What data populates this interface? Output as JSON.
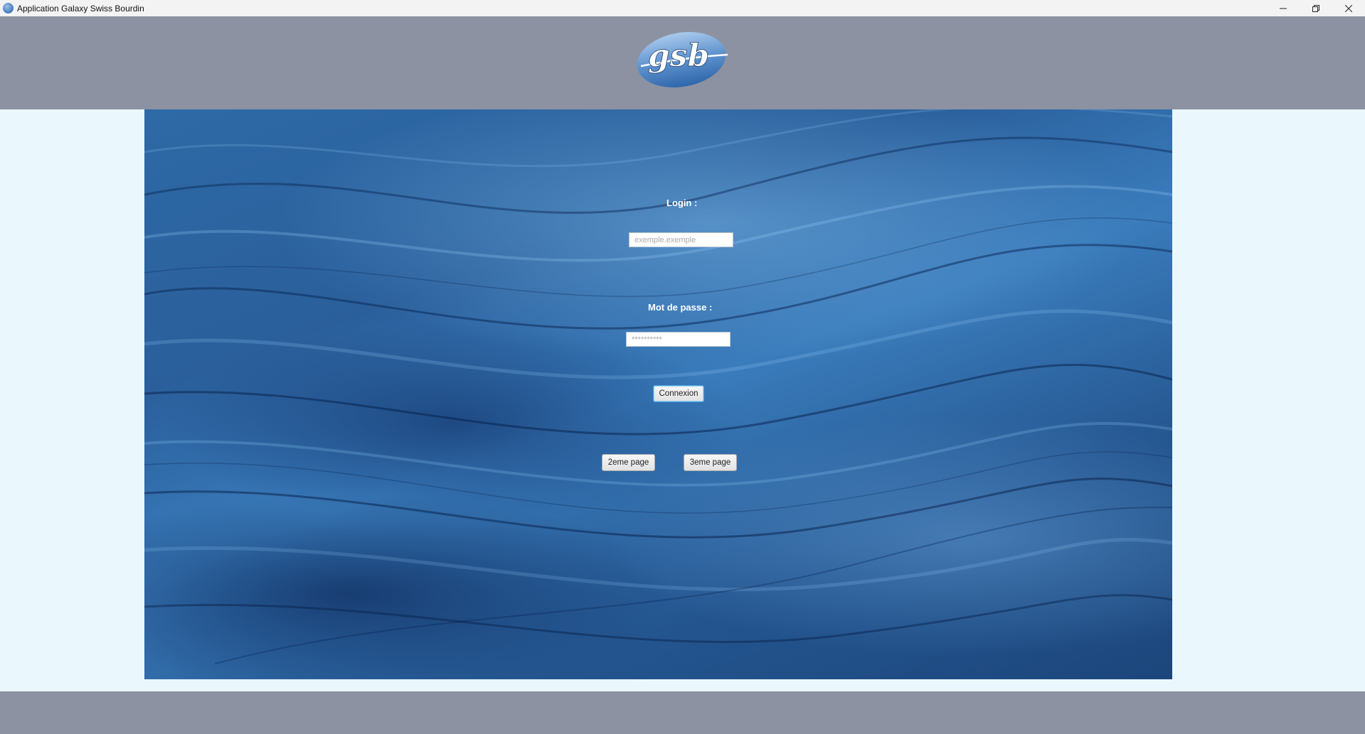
{
  "window": {
    "title": "Application Galaxy Swiss Bourdin",
    "icon": "gsb-app-icon",
    "controls": [
      "minimize-icon",
      "restore-icon",
      "close-icon"
    ]
  },
  "header": {
    "logo_text": "gsb"
  },
  "form": {
    "login_label": "Login :",
    "login_placeholder": "exemple.exemple",
    "password_label": "Mot de passe :",
    "password_placeholder": "**********",
    "connect_button": "Connexion",
    "page2_button": "2eme page",
    "page3_button": "3eme page"
  },
  "colors": {
    "header_bg": "#8c92a2",
    "band_bg": "#eaf8fd",
    "panel_base": "#2a5f9b"
  }
}
